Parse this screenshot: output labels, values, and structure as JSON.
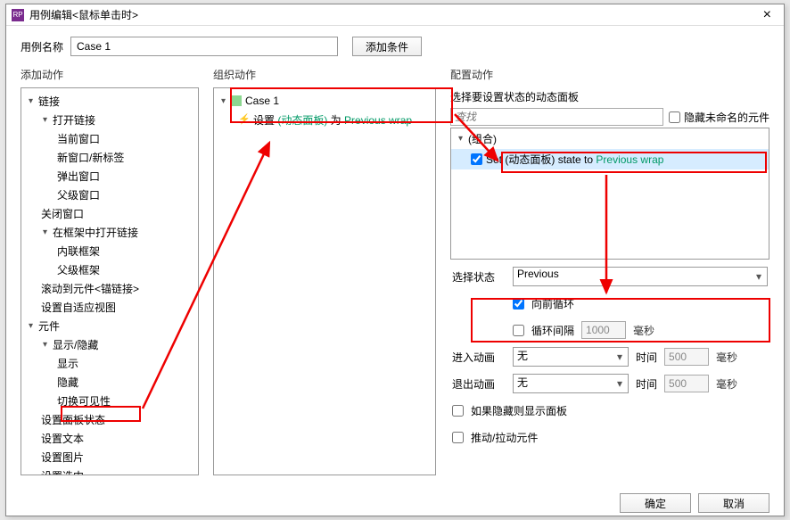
{
  "title": "用例编辑<鼠标单击时>",
  "header": {
    "case_label": "用例名称",
    "case_name": "Case 1",
    "add_condition": "添加条件"
  },
  "columns": {
    "add_action": "添加动作",
    "organize_action": "组织动作",
    "configure_action": "配置动作"
  },
  "tree": {
    "links": "链接",
    "open_link": "打开链接",
    "current_window": "当前窗口",
    "new_window": "新窗口/新标签",
    "popup_window": "弹出窗口",
    "parent_window": "父级窗口",
    "close_window": "关闭窗口",
    "open_in_frame": "在框架中打开链接",
    "inline_frame": "内联框架",
    "parent_frame": "父级框架",
    "scroll_anchor": "滚动到元件<锚链接>",
    "set_adaptive": "设置自适应视图",
    "widgets": "元件",
    "show_hide": "显示/隐藏",
    "show": "显示",
    "hide": "隐藏",
    "toggle_visible": "切换可见性",
    "set_panel_state": "设置面板状态",
    "set_text": "设置文本",
    "set_image": "设置图片",
    "set_selected": "设置选中"
  },
  "org": {
    "case1": "Case 1",
    "action_prefix": "设置 ",
    "action_panel": "(动态面板)",
    "action_mid": " 为 ",
    "action_target": "Previous wrap"
  },
  "config": {
    "select_panel": "选择要设置状态的动态面板",
    "search_placeholder": "查找",
    "hide_unnamed": "隐藏未命名的元件",
    "group": "(组合)",
    "set_prefix": "Set ",
    "set_panel": "(动态面板)",
    "set_mid": " state to ",
    "set_target": "Previous wrap",
    "select_state": "选择状态",
    "state_value": "Previous",
    "wrap_forward": "向前循环",
    "loop_interval": "循环间隔",
    "loop_ms": "1000",
    "ms": "毫秒",
    "anim_in": "进入动画",
    "anim_out": "退出动画",
    "none": "无",
    "time": "时间",
    "time_val": "500",
    "show_if_hidden": "如果隐藏则显示面板",
    "push_pull": "推动/拉动元件"
  },
  "buttons": {
    "ok": "确定",
    "cancel": "取消"
  }
}
